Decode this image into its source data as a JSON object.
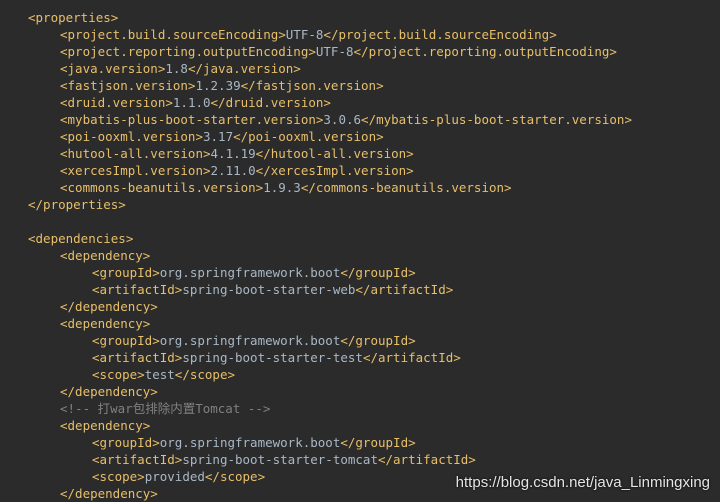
{
  "lines": [
    {
      "indent": 0,
      "kind": "tag",
      "open": "<properties>"
    },
    {
      "indent": 1,
      "kind": "elem",
      "open": "<project.build.sourceEncoding>",
      "value": "UTF-8",
      "close": "</project.build.sourceEncoding>"
    },
    {
      "indent": 1,
      "kind": "elem",
      "open": "<project.reporting.outputEncoding>",
      "value": "UTF-8",
      "close": "</project.reporting.outputEncoding>"
    },
    {
      "indent": 1,
      "kind": "elem",
      "open": "<java.version>",
      "value": "1.8",
      "close": "</java.version>"
    },
    {
      "indent": 1,
      "kind": "elem",
      "open": "<fastjson.version>",
      "value": "1.2.39",
      "close": "</fastjson.version>"
    },
    {
      "indent": 1,
      "kind": "elem",
      "open": "<druid.version>",
      "value": "1.1.0",
      "close": "</druid.version>"
    },
    {
      "indent": 1,
      "kind": "elem",
      "open": "<mybatis-plus-boot-starter.version>",
      "value": "3.0.6",
      "close": "</mybatis-plus-boot-starter.version>"
    },
    {
      "indent": 1,
      "kind": "elem",
      "open": "<poi-ooxml.version>",
      "value": "3.17",
      "close": "</poi-ooxml.version>"
    },
    {
      "indent": 1,
      "kind": "elem",
      "open": "<hutool-all.version>",
      "value": "4.1.19",
      "close": "</hutool-all.version>"
    },
    {
      "indent": 1,
      "kind": "elem",
      "open": "<xercesImpl.version>",
      "value": "2.11.0",
      "close": "</xercesImpl.version>"
    },
    {
      "indent": 1,
      "kind": "elem",
      "open": "<commons-beanutils.version>",
      "value": "1.9.3",
      "close": "</commons-beanutils.version>"
    },
    {
      "indent": 0,
      "kind": "tag",
      "open": "</properties>"
    },
    {
      "indent": 0,
      "kind": "blank"
    },
    {
      "indent": 0,
      "kind": "tag",
      "open": "<dependencies>"
    },
    {
      "indent": 1,
      "kind": "tag",
      "open": "<dependency>"
    },
    {
      "indent": 2,
      "kind": "elem",
      "open": "<groupId>",
      "value": "org.springframework.boot",
      "close": "</groupId>"
    },
    {
      "indent": 2,
      "kind": "elem",
      "open": "<artifactId>",
      "value": "spring-boot-starter-web",
      "close": "</artifactId>"
    },
    {
      "indent": 1,
      "kind": "tag",
      "open": "</dependency>"
    },
    {
      "indent": 1,
      "kind": "tag",
      "open": "<dependency>"
    },
    {
      "indent": 2,
      "kind": "elem",
      "open": "<groupId>",
      "value": "org.springframework.boot",
      "close": "</groupId>"
    },
    {
      "indent": 2,
      "kind": "elem",
      "open": "<artifactId>",
      "value": "spring-boot-starter-test",
      "close": "</artifactId>"
    },
    {
      "indent": 2,
      "kind": "elem",
      "open": "<scope>",
      "value": "test",
      "close": "</scope>"
    },
    {
      "indent": 1,
      "kind": "tag",
      "open": "</dependency>"
    },
    {
      "indent": 1,
      "kind": "comment",
      "open": "<!-- 打war包排除内置Tomcat -->"
    },
    {
      "indent": 1,
      "kind": "tag",
      "open": "<dependency>"
    },
    {
      "indent": 2,
      "kind": "elem",
      "open": "<groupId>",
      "value": "org.springframework.boot",
      "close": "</groupId>"
    },
    {
      "indent": 2,
      "kind": "elem",
      "open": "<artifactId>",
      "value": "spring-boot-starter-tomcat",
      "close": "</artifactId>"
    },
    {
      "indent": 2,
      "kind": "elem",
      "open": "<scope>",
      "value": "provided",
      "close": "</scope>"
    },
    {
      "indent": 1,
      "kind": "tag",
      "open": "</dependency>"
    }
  ],
  "watermark": "https://blog.csdn.net/java_Linmingxing",
  "colors": {
    "background": "#2b2b2b",
    "tag": "#e8bf6a",
    "text": "#a9b7c6",
    "comment": "#808080"
  }
}
